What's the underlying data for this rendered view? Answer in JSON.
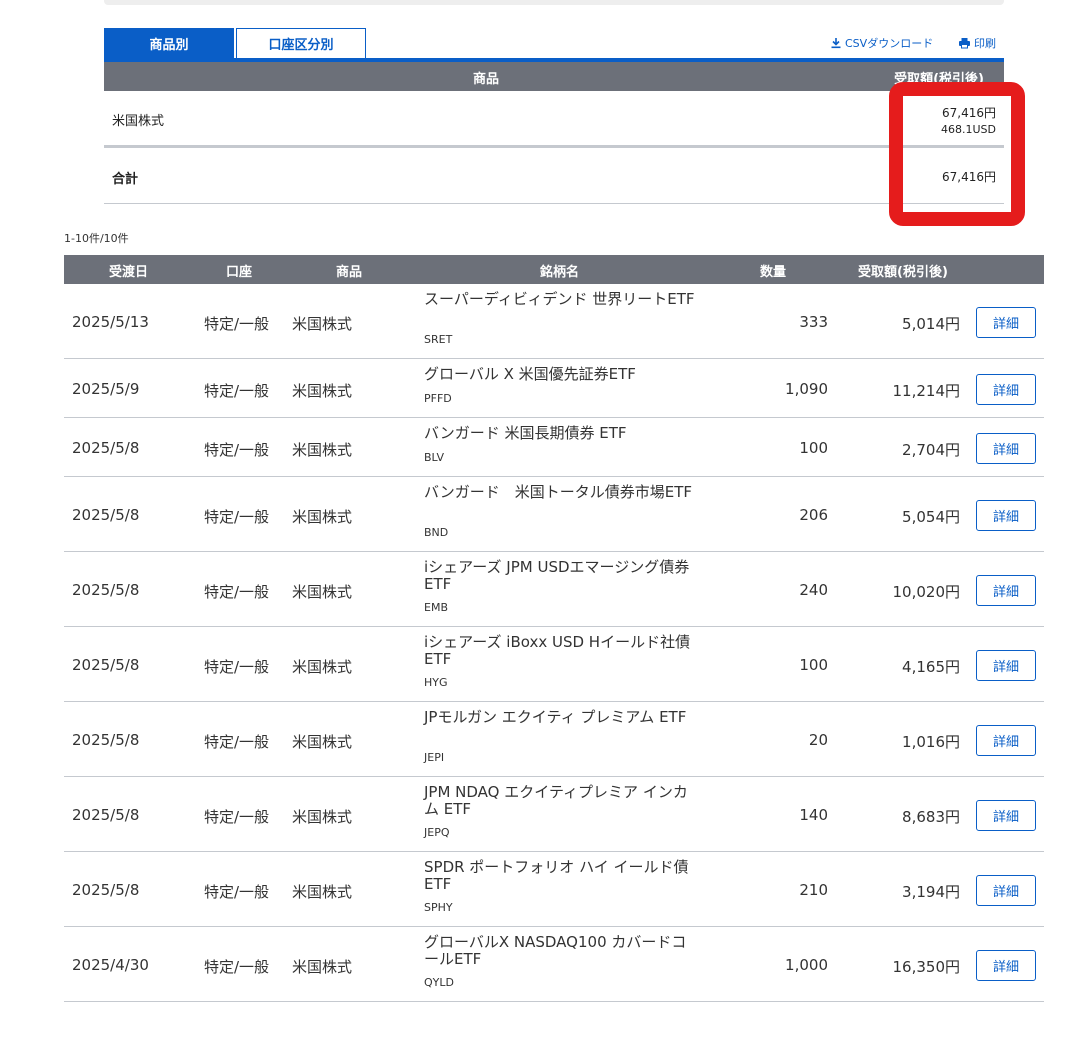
{
  "tabs": {
    "by_product": "商品別",
    "by_account": "口座区分別"
  },
  "tools": {
    "csv": "CSVダウンロード",
    "print": "印刷"
  },
  "summary": {
    "header_product": "商品",
    "header_amount": "受取額(税引後)",
    "rows": [
      {
        "label": "米国株式",
        "amount_jpy": "67,416円",
        "amount_usd": "468.1USD"
      }
    ],
    "total": {
      "label": "合計",
      "amount_jpy": "67,416円"
    }
  },
  "count_text": "1-10件/10件",
  "table": {
    "headers": {
      "date": "受渡日",
      "account": "口座",
      "product": "商品",
      "name": "銘柄名",
      "qty": "数量",
      "amount": "受取額(税引後)"
    },
    "detail_label": "詳細",
    "rows": [
      {
        "date": "2025/5/13",
        "account": "特定/一般",
        "product": "米国株式",
        "name": "スーパーディビィデンド 世界リートETF",
        "code": "SRET",
        "qty": "333",
        "amount": "5,014円"
      },
      {
        "date": "2025/5/9",
        "account": "特定/一般",
        "product": "米国株式",
        "name": "グローバル X 米国優先証券ETF",
        "code": "PFFD",
        "qty": "1,090",
        "amount": "11,214円"
      },
      {
        "date": "2025/5/8",
        "account": "特定/一般",
        "product": "米国株式",
        "name": "バンガード 米国長期債券 ETF",
        "code": "BLV",
        "qty": "100",
        "amount": "2,704円"
      },
      {
        "date": "2025/5/8",
        "account": "特定/一般",
        "product": "米国株式",
        "name": "バンガード　米国トータル債券市場ETF",
        "code": "BND",
        "qty": "206",
        "amount": "5,054円"
      },
      {
        "date": "2025/5/8",
        "account": "特定/一般",
        "product": "米国株式",
        "name": "iシェアーズ JPM USDエマージング債券 ETF",
        "code": "EMB",
        "qty": "240",
        "amount": "10,020円"
      },
      {
        "date": "2025/5/8",
        "account": "特定/一般",
        "product": "米国株式",
        "name": "iシェアーズ iBoxx USD Hイールド社債 ETF",
        "code": "HYG",
        "qty": "100",
        "amount": "4,165円"
      },
      {
        "date": "2025/5/8",
        "account": "特定/一般",
        "product": "米国株式",
        "name": "JPモルガン エクイティ プレミアム ETF",
        "code": "JEPI",
        "qty": "20",
        "amount": "1,016円"
      },
      {
        "date": "2025/5/8",
        "account": "特定/一般",
        "product": "米国株式",
        "name": "JPM NDAQ エクイティプレミア インカム ETF",
        "code": "JEPQ",
        "qty": "140",
        "amount": "8,683円"
      },
      {
        "date": "2025/5/8",
        "account": "特定/一般",
        "product": "米国株式",
        "name": "SPDR ポートフォリオ ハイ イールド債 ETF",
        "code": "SPHY",
        "qty": "210",
        "amount": "3,194円"
      },
      {
        "date": "2025/4/30",
        "account": "特定/一般",
        "product": "米国株式",
        "name": "グローバルX NASDAQ100 カバードコールETF",
        "code": "QYLD",
        "qty": "1,000",
        "amount": "16,350円"
      }
    ]
  }
}
